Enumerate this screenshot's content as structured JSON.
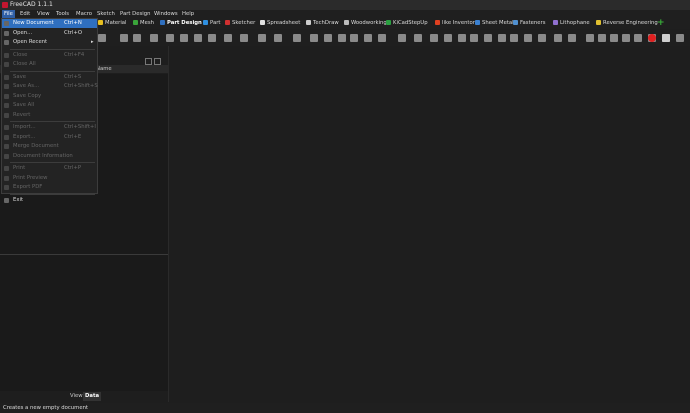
{
  "window": {
    "title": "FreeCAD 1.1.1"
  },
  "menubar": [
    {
      "label": "File",
      "active": true
    },
    {
      "label": "Edit"
    },
    {
      "label": "View"
    },
    {
      "label": "Tools"
    },
    {
      "label": "Macro"
    },
    {
      "label": "Sketch"
    },
    {
      "label": "Part Design"
    },
    {
      "label": "Windows"
    },
    {
      "label": "Help"
    }
  ],
  "workbenches": [
    {
      "label": "Material",
      "color": "#e8c020"
    },
    {
      "label": "Mesh",
      "color": "#3aa53a"
    },
    {
      "label": "Part Design",
      "color": "#2f6fbf",
      "active": true
    },
    {
      "label": "Part",
      "color": "#2f8fdf"
    },
    {
      "label": "Sketcher",
      "color": "#d03030"
    },
    {
      "label": "Spreadsheet",
      "color": "#e0e0e0"
    },
    {
      "label": "TechDraw",
      "color": "#cccccc"
    },
    {
      "label": "Woodworking",
      "color": "#bbbbbb"
    },
    {
      "label": "KiCadStepUp",
      "color": "#2aa040"
    },
    {
      "label": "like Inventor",
      "color": "#e04020"
    },
    {
      "label": "Sheet Metal",
      "color": "#3a80d0"
    },
    {
      "label": "Fasteners",
      "color": "#5090d0"
    },
    {
      "label": "Lithophane",
      "color": "#9070d0"
    },
    {
      "label": "Reverse Engineering",
      "color": "#e0c030"
    }
  ],
  "add_workbench_symbol": "+",
  "tree": {
    "column_header": "Name"
  },
  "view_tabs": [
    {
      "label": "View"
    },
    {
      "label": "Data",
      "active": true
    }
  ],
  "file_menu": [
    {
      "label": "New Document",
      "shortcut": "Ctrl+N",
      "state": "selected"
    },
    {
      "label": "Open...",
      "shortcut": "Ctrl+O"
    },
    {
      "label": "Open Recent",
      "submenu": true
    },
    {
      "separator": true
    },
    {
      "label": "Close",
      "shortcut": "Ctrl+F4",
      "state": "disabled"
    },
    {
      "label": "Close All",
      "state": "disabled"
    },
    {
      "separator": true
    },
    {
      "label": "Save",
      "shortcut": "Ctrl+S",
      "state": "disabled"
    },
    {
      "label": "Save As...",
      "shortcut": "Ctrl+Shift+S",
      "state": "disabled"
    },
    {
      "label": "Save Copy",
      "state": "disabled"
    },
    {
      "label": "Save All",
      "state": "disabled"
    },
    {
      "label": "Revert",
      "state": "disabled"
    },
    {
      "separator": true
    },
    {
      "label": "Import...",
      "shortcut": "Ctrl+Shift+I",
      "state": "disabled"
    },
    {
      "label": "Export...",
      "shortcut": "Ctrl+E",
      "state": "disabled"
    },
    {
      "label": "Merge Document",
      "state": "disabled"
    },
    {
      "label": "Document Information",
      "state": "disabled"
    },
    {
      "separator": true
    },
    {
      "label": "Print",
      "shortcut": "Ctrl+P",
      "state": "disabled"
    },
    {
      "label": "Print Preview",
      "state": "disabled"
    },
    {
      "label": "Export PDF",
      "state": "disabled"
    },
    {
      "separator": true
    },
    {
      "label": "Exit"
    }
  ],
  "status": {
    "message": "Creates a new empty document"
  }
}
